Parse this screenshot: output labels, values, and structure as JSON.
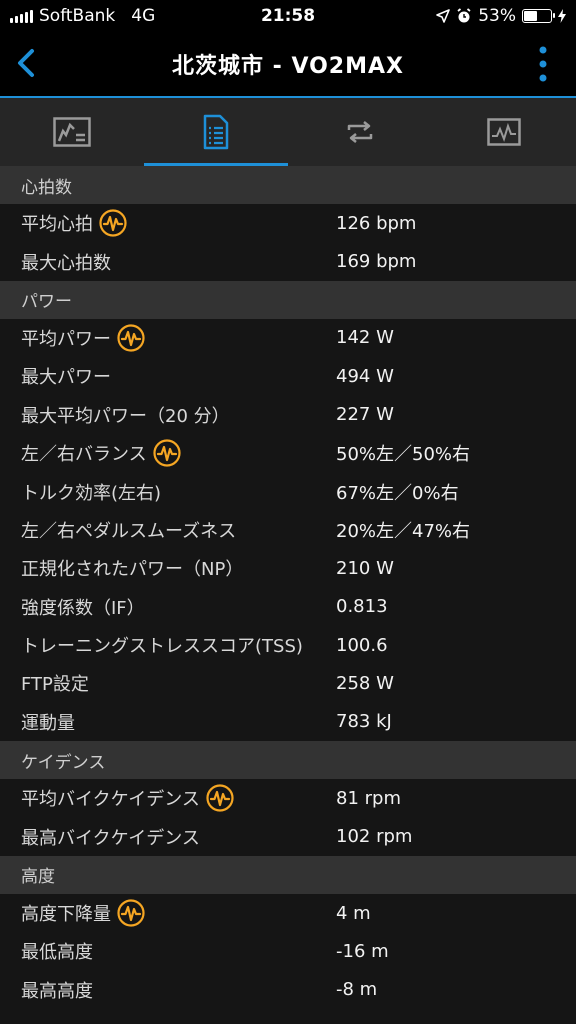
{
  "status_bar": {
    "carrier": "SoftBank",
    "network": "4G",
    "time": "21:58",
    "battery_percent": "53%",
    "battery_level": 0.53
  },
  "header": {
    "title": "北茨城市 - VO2MAX"
  },
  "colors": {
    "accent_blue": "#1e90d8",
    "badge_orange": "#f5a623"
  },
  "tabs": [
    {
      "icon": "chart-icon",
      "active": false
    },
    {
      "icon": "list-document-icon",
      "active": true
    },
    {
      "icon": "repeat-icon",
      "active": false
    },
    {
      "icon": "activity-graph-icon",
      "active": false
    }
  ],
  "sections": [
    {
      "title": "心拍数",
      "rows": [
        {
          "label": "平均心拍",
          "value": "126 bpm",
          "badge": true
        },
        {
          "label": "最大心拍数",
          "value": "169 bpm",
          "badge": false
        }
      ]
    },
    {
      "title": "パワー",
      "rows": [
        {
          "label": "平均パワー",
          "value": "142 W",
          "badge": true
        },
        {
          "label": "最大パワー",
          "value": "494 W",
          "badge": false
        },
        {
          "label": "最大平均パワー（20 分）",
          "value": "227 W",
          "badge": false
        },
        {
          "label": "左／右バランス",
          "value": "50%左／50%右",
          "badge": true
        },
        {
          "label": "トルク効率(左右)",
          "value": "67%左／0%右",
          "badge": false
        },
        {
          "label": "左／右ペダルスムーズネス",
          "value": "20%左／47%右",
          "badge": false
        },
        {
          "label": "正規化されたパワー（NP）",
          "value": "210 W",
          "badge": false
        },
        {
          "label": "強度係数（IF）",
          "value": "0.813",
          "badge": false
        },
        {
          "label": "トレーニングストレススコア(TSS)",
          "value": "100.6",
          "badge": false
        },
        {
          "label": "FTP設定",
          "value": "258 W",
          "badge": false
        },
        {
          "label": "運動量",
          "value": "783 kJ",
          "badge": false
        }
      ]
    },
    {
      "title": "ケイデンス",
      "rows": [
        {
          "label": "平均バイクケイデンス",
          "value": "81 rpm",
          "badge": true
        },
        {
          "label": "最高バイクケイデンス",
          "value": "102 rpm",
          "badge": false
        }
      ]
    },
    {
      "title": "高度",
      "rows": [
        {
          "label": "高度下降量",
          "value": "4 m",
          "badge": true
        },
        {
          "label": "最低高度",
          "value": "-16 m",
          "badge": false
        },
        {
          "label": "最高高度",
          "value": "-8 m",
          "badge": false
        }
      ]
    }
  ]
}
